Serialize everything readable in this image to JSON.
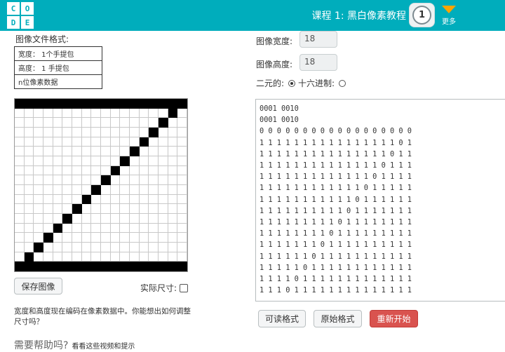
{
  "header": {
    "logo_letters": [
      "C",
      "O",
      "D",
      "E"
    ],
    "lesson_title": "课程 1: 黑白像素教程",
    "level_number": "1",
    "more_label": "更多"
  },
  "format_panel": {
    "title": "图像文件格式:",
    "rows": [
      "宽度： 1个手提包",
      "高度： 1 手提包",
      "n位像素数据"
    ]
  },
  "pixel_grid": {
    "width": 18,
    "height": 18,
    "on_color": "#000000",
    "off_color": "#ffffff"
  },
  "controls": {
    "save_image_label": "保存图像",
    "actual_size_label": "实际尺寸:",
    "hint_text": "宽度和高度现在编码在像素数据中。你能想出如何调整尺寸吗？",
    "help_title": "需要帮助吗?",
    "help_link": "看看这些视频和提示"
  },
  "image_settings": {
    "width_label": "图像宽度:",
    "width_value": "18",
    "height_label": "图像高度:",
    "height_value": "18",
    "binary_label": "二元的:",
    "hex_label": "十六进制:",
    "selected_encoding": "binary"
  },
  "code_lines": [
    "0001 0010",
    "0001 0010",
    "0 0 0 0 0 0 0 0 0 0 0 0 0 0 0 0 0 0",
    "1 1 1 1 1 1 1 1 1 1 1 1 1 1 1 1 0 1",
    "1 1 1 1 1 1 1 1 1 1 1 1 1 1 1 0 1 1",
    "1 1 1 1 1 1 1 1 1 1 1 1 1 1 0 1 1 1",
    "1 1 1 1 1 1 1 1 1 1 1 1 1 0 1 1 1 1",
    "1 1 1 1 1 1 1 1 1 1 1 1 0 1 1 1 1 1",
    "1 1 1 1 1 1 1 1 1 1 1 0 1 1 1 1 1 1",
    "1 1 1 1 1 1 1 1 1 1 0 1 1 1 1 1 1 1",
    "1 1 1 1 1 1 1 1 1 0 1 1 1 1 1 1 1 1",
    "1 1 1 1 1 1 1 1 0 1 1 1 1 1 1 1 1 1",
    "1 1 1 1 1 1 1 0 1 1 1 1 1 1 1 1 1 1",
    "1 1 1 1 1 1 0 1 1 1 1 1 1 1 1 1 1 1",
    "1 1 1 1 1 0 1 1 1 1 1 1 1 1 1 1 1 1",
    "1 1 1 1 0 1 1 1 1 1 1 1 1 1 1 1 1 1",
    "1 1 1 0 1 1 1 1 1 1 1 1 1 1 1 1 1 1"
  ],
  "pixel_rows": [
    "000000000000000000",
    "111111111111111101",
    "111111111111111011",
    "111111111111110111",
    "111111111111101111",
    "111111111111011111",
    "111111111110111111",
    "111111111101111111",
    "111111111011111111",
    "111111110111111111",
    "111111101111111111",
    "111111011111111111",
    "111110111111111111",
    "111101111111111111",
    "111011111111111111",
    "110111111111111111",
    "101111111111111111",
    "000000000000000000"
  ],
  "buttons": {
    "readable_format": "可读格式",
    "raw_format": "原始格式",
    "restart": "重新开始"
  }
}
